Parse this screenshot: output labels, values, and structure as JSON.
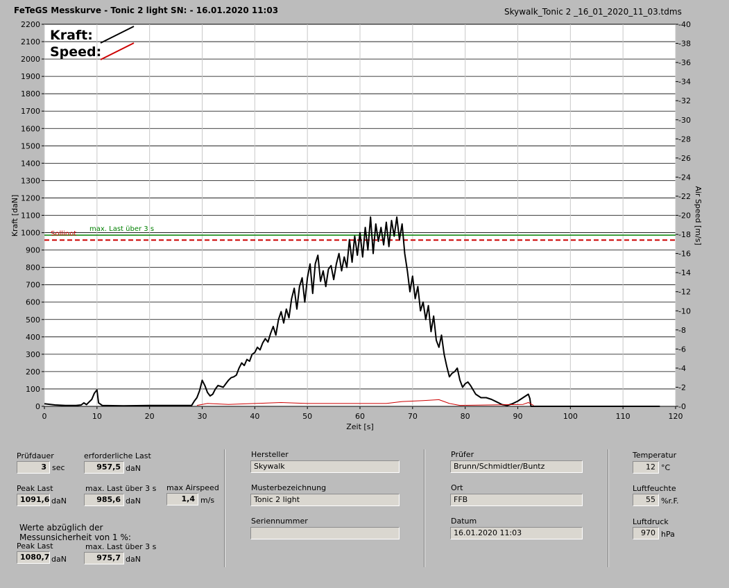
{
  "header": {
    "title": "FeTeGS Messkurve - Tonic 2 light  SN:  - 16.01.2020 11:03",
    "filename": "Skywalk_Tonic 2 _16_01_2020_11_03.tdms"
  },
  "chart_data": {
    "type": "line",
    "xlabel": "Zeit [s]",
    "ylabel": "Kraft [daN]",
    "y2label": "Air Speed [m/s]",
    "xlim": [
      0,
      120
    ],
    "ylim": [
      0,
      2200
    ],
    "y2lim": [
      0,
      40
    ],
    "x_ticks": [
      "0",
      "10",
      "20",
      "30",
      "40",
      "50",
      "60",
      "70",
      "80",
      "90",
      "100",
      "110",
      "120"
    ],
    "y_ticks": [
      "0",
      "100",
      "200",
      "300",
      "400",
      "500",
      "600",
      "700",
      "800",
      "900",
      "1000",
      "1100",
      "1200",
      "1300",
      "1400",
      "1500",
      "1600",
      "1700",
      "1800",
      "1900",
      "2000",
      "2100",
      "2200"
    ],
    "y2_ticks": [
      "0",
      "2",
      "4",
      "6",
      "8",
      "10",
      "12",
      "14",
      "16",
      "18",
      "20",
      "22",
      "24",
      "26",
      "28",
      "30",
      "32",
      "34",
      "36",
      "38",
      "40"
    ],
    "grid": true,
    "legend_position": "top-left",
    "legend": [
      {
        "name": "Kraft:",
        "color": "#000000"
      },
      {
        "name": "Speed:",
        "color": "#cc0000"
      }
    ],
    "reference_lines": [
      {
        "label": "max. Last über  3 s",
        "value": 985.6,
        "color": "#008000",
        "style": "solid"
      },
      {
        "label": "Sollinot",
        "value": 957.5,
        "color": "#cc0000",
        "style": "dashed"
      }
    ],
    "series": [
      {
        "name": "Kraft",
        "color": "#000000",
        "points": [
          [
            0,
            15
          ],
          [
            2,
            8
          ],
          [
            4,
            5
          ],
          [
            6,
            5
          ],
          [
            7,
            8
          ],
          [
            7.5,
            20
          ],
          [
            8,
            10
          ],
          [
            8.5,
            25
          ],
          [
            9,
            40
          ],
          [
            9.5,
            75
          ],
          [
            10,
            95
          ],
          [
            10.3,
            20
          ],
          [
            11,
            5
          ],
          [
            15,
            3
          ],
          [
            20,
            5
          ],
          [
            25,
            5
          ],
          [
            28,
            5
          ],
          [
            28.5,
            30
          ],
          [
            29,
            50
          ],
          [
            29.5,
            90
          ],
          [
            30,
            150
          ],
          [
            30.5,
            120
          ],
          [
            31,
            80
          ],
          [
            31.5,
            60
          ],
          [
            32,
            70
          ],
          [
            32.5,
            100
          ],
          [
            33,
            120
          ],
          [
            34,
            110
          ],
          [
            34.5,
            130
          ],
          [
            35,
            150
          ],
          [
            35.5,
            165
          ],
          [
            36,
            170
          ],
          [
            36.5,
            180
          ],
          [
            37,
            220
          ],
          [
            37.5,
            250
          ],
          [
            38,
            235
          ],
          [
            38.5,
            270
          ],
          [
            39,
            260
          ],
          [
            39.5,
            300
          ],
          [
            40,
            310
          ],
          [
            40.5,
            340
          ],
          [
            41,
            325
          ],
          [
            41.5,
            365
          ],
          [
            42,
            390
          ],
          [
            42.5,
            370
          ],
          [
            43,
            420
          ],
          [
            43.5,
            460
          ],
          [
            44,
            410
          ],
          [
            44.5,
            500
          ],
          [
            45,
            545
          ],
          [
            45.5,
            480
          ],
          [
            46,
            560
          ],
          [
            46.5,
            510
          ],
          [
            47,
            620
          ],
          [
            47.5,
            680
          ],
          [
            48,
            560
          ],
          [
            48.5,
            690
          ],
          [
            49,
            740
          ],
          [
            49.5,
            600
          ],
          [
            50,
            740
          ],
          [
            50.5,
            820
          ],
          [
            51,
            650
          ],
          [
            51.5,
            820
          ],
          [
            52,
            870
          ],
          [
            52.5,
            720
          ],
          [
            53,
            780
          ],
          [
            53.5,
            690
          ],
          [
            54,
            790
          ],
          [
            54.5,
            810
          ],
          [
            55,
            730
          ],
          [
            55.5,
            820
          ],
          [
            56,
            880
          ],
          [
            56.5,
            780
          ],
          [
            57,
            860
          ],
          [
            57.5,
            800
          ],
          [
            58,
            960
          ],
          [
            58.5,
            830
          ],
          [
            59,
            980
          ],
          [
            59.5,
            870
          ],
          [
            60,
            1000
          ],
          [
            60.5,
            860
          ],
          [
            61,
            1030
          ],
          [
            61.5,
            900
          ],
          [
            62,
            1090
          ],
          [
            62.5,
            880
          ],
          [
            63,
            1050
          ],
          [
            63.5,
            950
          ],
          [
            64,
            1030
          ],
          [
            64.5,
            930
          ],
          [
            65,
            1060
          ],
          [
            65.5,
            920
          ],
          [
            66,
            1070
          ],
          [
            66.5,
            980
          ],
          [
            67,
            1090
          ],
          [
            67.5,
            960
          ],
          [
            68,
            1050
          ],
          [
            68.5,
            880
          ],
          [
            69,
            780
          ],
          [
            69.5,
            660
          ],
          [
            70,
            750
          ],
          [
            70.5,
            620
          ],
          [
            71,
            690
          ],
          [
            71.5,
            550
          ],
          [
            72,
            600
          ],
          [
            72.5,
            500
          ],
          [
            73,
            580
          ],
          [
            73.5,
            430
          ],
          [
            74,
            520
          ],
          [
            74.5,
            380
          ],
          [
            75,
            340
          ],
          [
            75.5,
            410
          ],
          [
            76,
            300
          ],
          [
            76.5,
            230
          ],
          [
            77,
            170
          ],
          [
            77.5,
            190
          ],
          [
            78,
            200
          ],
          [
            78.5,
            220
          ],
          [
            79,
            150
          ],
          [
            79.5,
            110
          ],
          [
            80,
            130
          ],
          [
            80.5,
            140
          ],
          [
            81,
            120
          ],
          [
            82,
            70
          ],
          [
            83,
            50
          ],
          [
            84,
            50
          ],
          [
            85,
            40
          ],
          [
            86,
            25
          ],
          [
            87,
            10
          ],
          [
            88,
            5
          ],
          [
            89,
            15
          ],
          [
            90,
            30
          ],
          [
            91,
            50
          ],
          [
            91.5,
            60
          ],
          [
            92,
            70
          ],
          [
            92.3,
            45
          ],
          [
            92.5,
            0
          ],
          [
            117,
            0
          ]
        ]
      },
      {
        "name": "Speed",
        "color": "#cc0000",
        "points": [
          [
            29,
            0.1
          ],
          [
            31,
            0.3
          ],
          [
            35,
            0.2
          ],
          [
            40,
            0.3
          ],
          [
            45,
            0.4
          ],
          [
            50,
            0.3
          ],
          [
            55,
            0.3
          ],
          [
            60,
            0.3
          ],
          [
            65,
            0.3
          ],
          [
            68,
            0.5
          ],
          [
            72,
            0.6
          ],
          [
            75,
            0.7
          ],
          [
            77,
            0.3
          ],
          [
            79,
            0.1
          ],
          [
            91,
            0.2
          ],
          [
            92,
            0.4
          ],
          [
            93,
            0.1
          ]
        ]
      }
    ]
  },
  "left_panel": {
    "pruefdauer_label": "Prüfdauer",
    "pruefdauer_value": "3",
    "pruefdauer_unit": "sec",
    "erf_last_label": "erforderliche Last",
    "erf_last_value": "957,5",
    "erf_last_unit": "daN",
    "peak_last_label": "Peak Last",
    "peak_last_value": "1091,6",
    "peak_last_unit": "daN",
    "max_last_label": "max. Last über  3 s",
    "max_last_value": "985,6",
    "max_last_unit": "daN",
    "max_airspeed_label": "max Airspeed",
    "max_airspeed_value": "1,4",
    "max_airspeed_unit": "m/s",
    "werte_line1": "Werte abzüglich der",
    "werte_line2": "Messunsicherheit von 1  %:",
    "peak_last2_label": "Peak Last",
    "peak_last2_value": "1080,7",
    "peak_last2_unit": "daN",
    "max_last2_label": "max. Last über  3 s",
    "max_last2_value": "975,7",
    "max_last2_unit": "daN"
  },
  "middle_panel": {
    "hersteller_label": "Hersteller",
    "hersteller_value": "Skywalk",
    "muster_label": "Musterbezeichnung",
    "muster_value": "Tonic 2 light",
    "serien_label": "Seriennummer",
    "serien_value": ""
  },
  "right_panel": {
    "pruefer_label": "Prüfer",
    "pruefer_value": "Brunn/Schmidtler/Buntz",
    "ort_label": "Ort",
    "ort_value": "FFB",
    "datum_label": "Datum",
    "datum_value": "16.01.2020 11:03"
  },
  "env_panel": {
    "temp_label": "Temperatur",
    "temp_value": "12",
    "temp_unit": "°C",
    "feuchte_label": "Luftfeuchte",
    "feuchte_value": "55",
    "feuchte_unit": "%r.F.",
    "druck_label": "Luftdruck",
    "druck_value": "970",
    "druck_unit": "hPa"
  }
}
